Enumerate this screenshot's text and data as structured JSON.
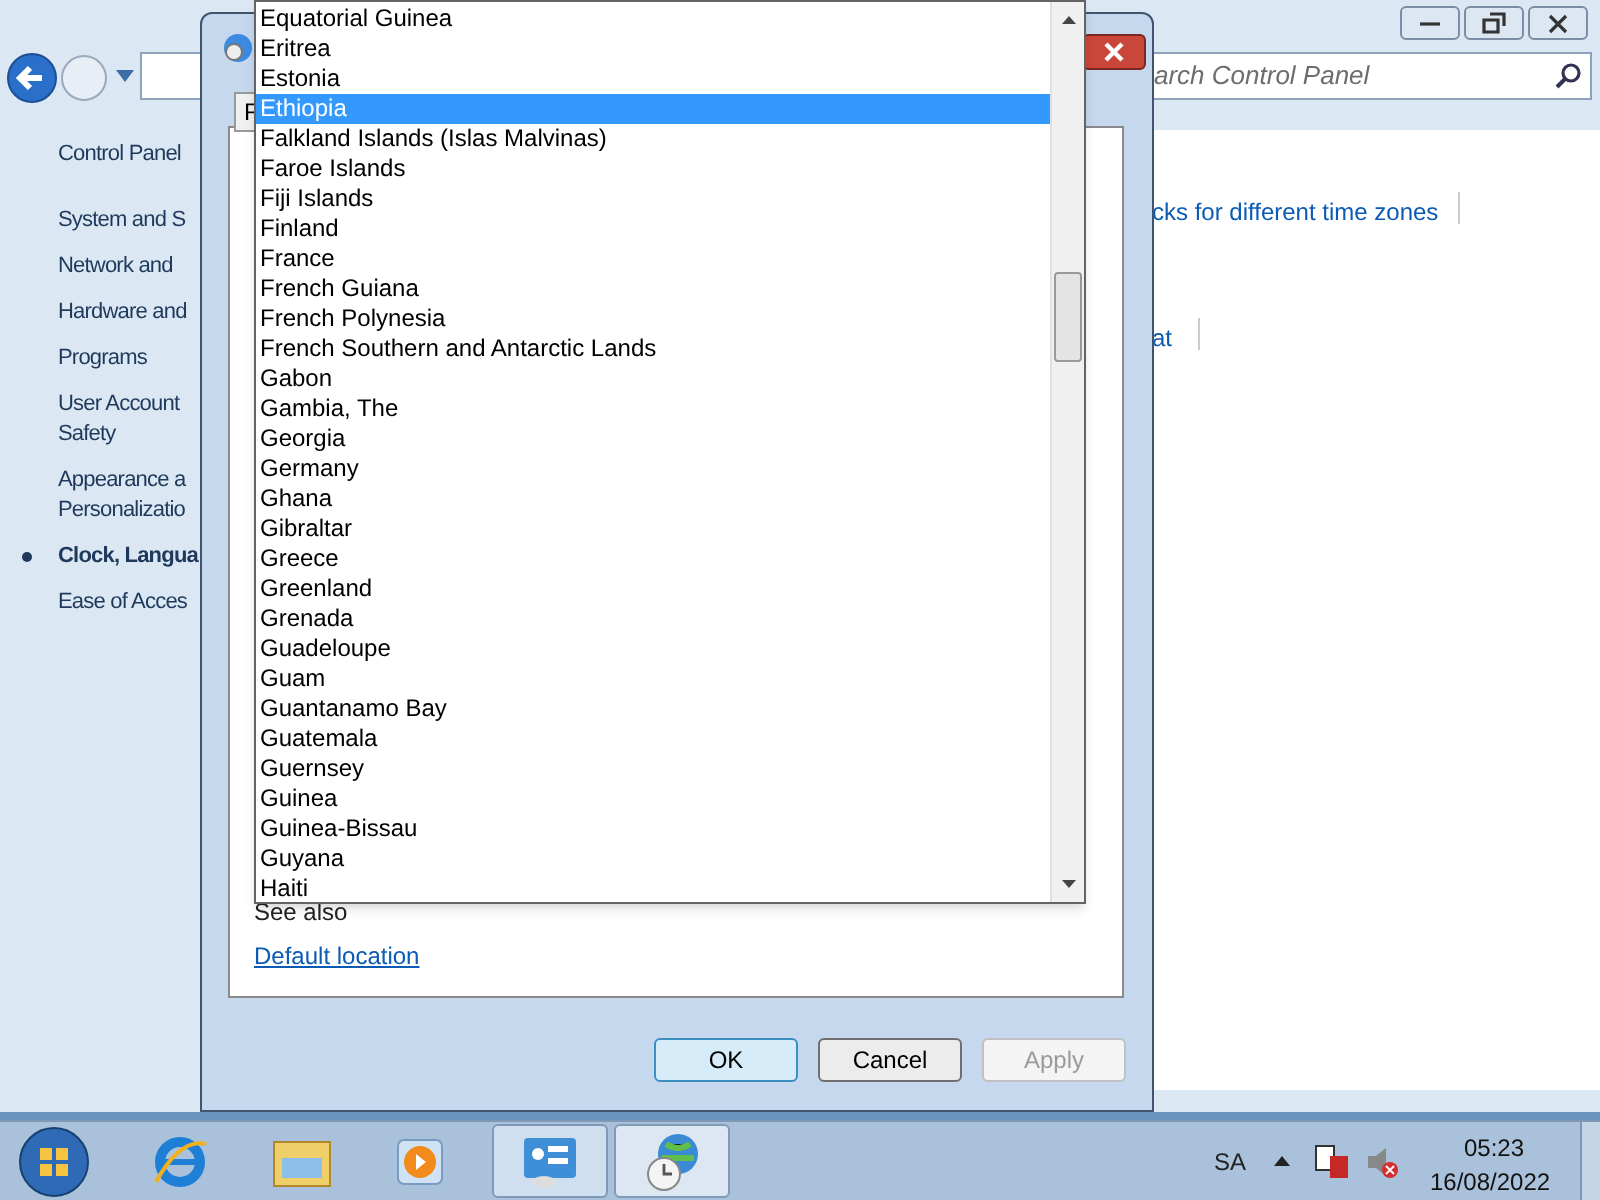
{
  "control_panel": {
    "search": {
      "placeholder": "arch Control Panel"
    },
    "sidebar": [
      {
        "label": "Control Panel",
        "selected": false
      },
      {
        "label": "System and S",
        "selected": false
      },
      {
        "label": "Network and",
        "selected": false
      },
      {
        "label": "Hardware and",
        "selected": false
      },
      {
        "label": "Programs",
        "selected": false
      },
      {
        "label": "User Account\nSafety",
        "selected": false
      },
      {
        "label": "Appearance a\nPersonalizatio",
        "selected": false
      },
      {
        "label": "Clock, Langua",
        "selected": true
      },
      {
        "label": "Ease of Acces",
        "selected": false
      }
    ],
    "links": [
      "cks for different time zones",
      "at"
    ]
  },
  "dialog": {
    "combo_label": "F",
    "see_also": "See also",
    "default_location_link": "Default location",
    "buttons": [
      {
        "label": "OK",
        "disabled": false
      },
      {
        "label": "Cancel",
        "disabled": false
      },
      {
        "label": "Apply",
        "disabled": true
      }
    ]
  },
  "dropdown": {
    "items": [
      {
        "label": "Equatorial Guinea",
        "selected": false
      },
      {
        "label": "Eritrea",
        "selected": false
      },
      {
        "label": "Estonia",
        "selected": false
      },
      {
        "label": "Ethiopia",
        "selected": true
      },
      {
        "label": "Falkland Islands (Islas Malvinas)",
        "selected": false
      },
      {
        "label": "Faroe Islands",
        "selected": false
      },
      {
        "label": "Fiji Islands",
        "selected": false
      },
      {
        "label": "Finland",
        "selected": false
      },
      {
        "label": "France",
        "selected": false
      },
      {
        "label": "French Guiana",
        "selected": false
      },
      {
        "label": "French Polynesia",
        "selected": false
      },
      {
        "label": "French Southern and Antarctic Lands",
        "selected": false
      },
      {
        "label": "Gabon",
        "selected": false
      },
      {
        "label": "Gambia, The",
        "selected": false
      },
      {
        "label": "Georgia",
        "selected": false
      },
      {
        "label": "Germany",
        "selected": false
      },
      {
        "label": "Ghana",
        "selected": false
      },
      {
        "label": "Gibraltar",
        "selected": false
      },
      {
        "label": "Greece",
        "selected": false
      },
      {
        "label": "Greenland",
        "selected": false
      },
      {
        "label": "Grenada",
        "selected": false
      },
      {
        "label": "Guadeloupe",
        "selected": false
      },
      {
        "label": "Guam",
        "selected": false
      },
      {
        "label": "Guantanamo Bay",
        "selected": false
      },
      {
        "label": "Guatemala",
        "selected": false
      },
      {
        "label": "Guernsey",
        "selected": false
      },
      {
        "label": "Guinea",
        "selected": false
      },
      {
        "label": "Guinea-Bissau",
        "selected": false
      },
      {
        "label": "Guyana",
        "selected": false
      },
      {
        "label": "Haiti",
        "selected": false
      }
    ]
  },
  "taskbar": {
    "language": "SA",
    "time": "05:23",
    "date": "16/08/2022"
  }
}
